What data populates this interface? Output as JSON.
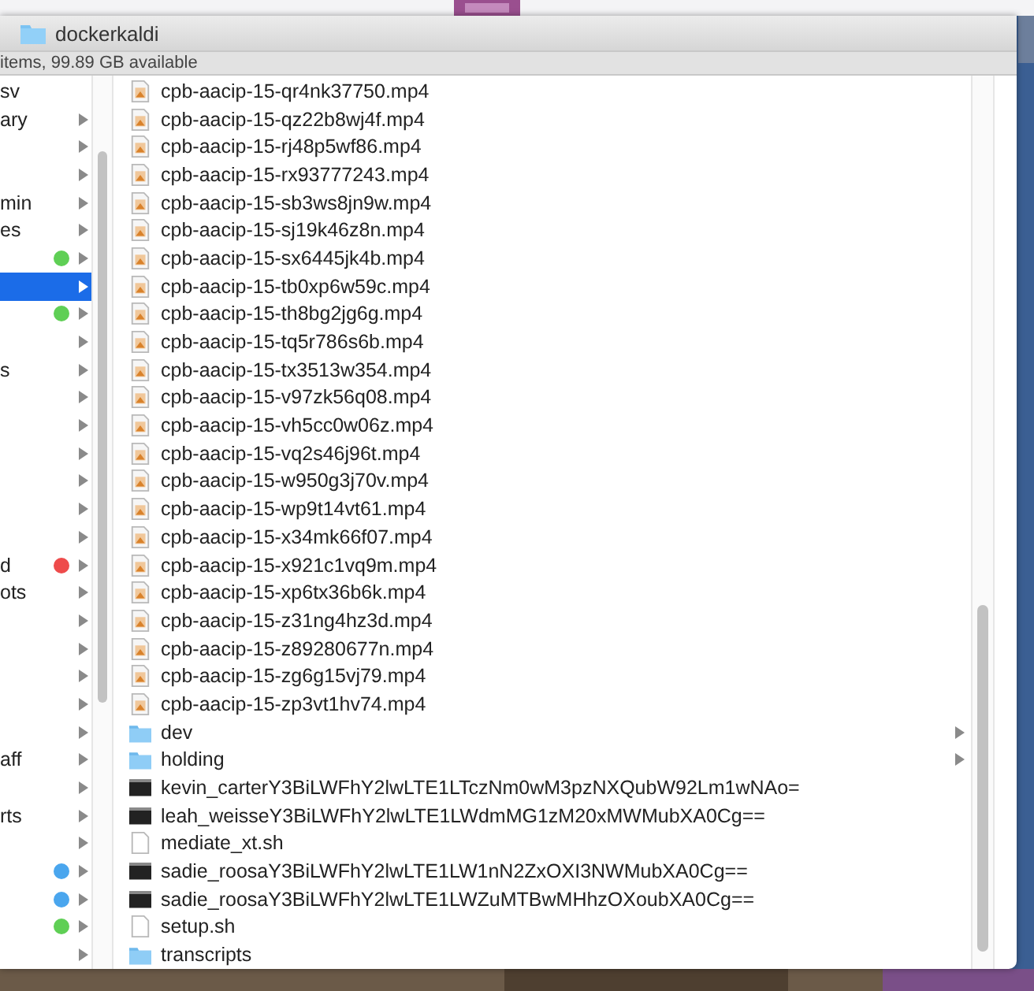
{
  "window": {
    "title": "dockerkaldi"
  },
  "status_bar": "items, 99.89 GB available",
  "left_column": [
    {
      "label": "sv",
      "selected": false,
      "chevron": false
    },
    {
      "label": "ary",
      "selected": false,
      "chevron": true
    },
    {
      "selected": false,
      "chevron": true
    },
    {
      "selected": false,
      "chevron": true
    },
    {
      "label": "min",
      "selected": false,
      "chevron": true
    },
    {
      "label": "es",
      "selected": false,
      "chevron": true
    },
    {
      "selected": false,
      "chevron": true,
      "color": "#5fcf55"
    },
    {
      "selected": true,
      "chevron": true
    },
    {
      "selected": false,
      "chevron": true,
      "color": "#5fcf55"
    },
    {
      "selected": false,
      "chevron": true
    },
    {
      "label": "s",
      "selected": false,
      "chevron": true
    },
    {
      "selected": false,
      "chevron": true
    },
    {
      "selected": false,
      "chevron": true
    },
    {
      "selected": false,
      "chevron": true
    },
    {
      "selected": false,
      "chevron": true
    },
    {
      "selected": false,
      "chevron": true
    },
    {
      "selected": false,
      "chevron": true
    },
    {
      "label": "d",
      "selected": false,
      "chevron": true,
      "color": "#ee4b4b"
    },
    {
      "label": "ots",
      "selected": false,
      "chevron": true
    },
    {
      "selected": false,
      "chevron": true
    },
    {
      "selected": false,
      "chevron": true
    },
    {
      "selected": false,
      "chevron": true
    },
    {
      "selected": false,
      "chevron": true
    },
    {
      "selected": false,
      "chevron": true
    },
    {
      "label": "aff",
      "selected": false,
      "chevron": true
    },
    {
      "selected": false,
      "chevron": true
    },
    {
      "label": "rts",
      "selected": false,
      "chevron": true
    },
    {
      "selected": false,
      "chevron": true
    },
    {
      "selected": false,
      "chevron": true,
      "color": "#4aa6ee"
    },
    {
      "selected": false,
      "chevron": true,
      "color": "#4aa6ee"
    },
    {
      "selected": false,
      "chevron": true,
      "color": "#5fcf55"
    },
    {
      "selected": false,
      "chevron": true
    }
  ],
  "files": [
    {
      "name": "cpb-aacip-15-qr4nk37750.mp4",
      "kind": "video"
    },
    {
      "name": "cpb-aacip-15-qz22b8wj4f.mp4",
      "kind": "video"
    },
    {
      "name": "cpb-aacip-15-rj48p5wf86.mp4",
      "kind": "video"
    },
    {
      "name": "cpb-aacip-15-rx93777243.mp4",
      "kind": "video"
    },
    {
      "name": "cpb-aacip-15-sb3ws8jn9w.mp4",
      "kind": "video"
    },
    {
      "name": "cpb-aacip-15-sj19k46z8n.mp4",
      "kind": "video"
    },
    {
      "name": "cpb-aacip-15-sx6445jk4b.mp4",
      "kind": "video"
    },
    {
      "name": "cpb-aacip-15-tb0xp6w59c.mp4",
      "kind": "video"
    },
    {
      "name": "cpb-aacip-15-th8bg2jg6g.mp4",
      "kind": "video"
    },
    {
      "name": "cpb-aacip-15-tq5r786s6b.mp4",
      "kind": "video"
    },
    {
      "name": "cpb-aacip-15-tx3513w354.mp4",
      "kind": "video"
    },
    {
      "name": "cpb-aacip-15-v97zk56q08.mp4",
      "kind": "video"
    },
    {
      "name": "cpb-aacip-15-vh5cc0w06z.mp4",
      "kind": "video"
    },
    {
      "name": "cpb-aacip-15-vq2s46j96t.mp4",
      "kind": "video"
    },
    {
      "name": "cpb-aacip-15-w950g3j70v.mp4",
      "kind": "video"
    },
    {
      "name": "cpb-aacip-15-wp9t14vt61.mp4",
      "kind": "video"
    },
    {
      "name": "cpb-aacip-15-x34mk66f07.mp4",
      "kind": "video"
    },
    {
      "name": "cpb-aacip-15-x921c1vq9m.mp4",
      "kind": "video"
    },
    {
      "name": "cpb-aacip-15-xp6tx36b6k.mp4",
      "kind": "video"
    },
    {
      "name": "cpb-aacip-15-z31ng4hz3d.mp4",
      "kind": "video"
    },
    {
      "name": "cpb-aacip-15-z89280677n.mp4",
      "kind": "video"
    },
    {
      "name": "cpb-aacip-15-zg6g15vj79.mp4",
      "kind": "video"
    },
    {
      "name": "cpb-aacip-15-zp3vt1hv74.mp4",
      "kind": "video"
    },
    {
      "name": "dev",
      "kind": "folder"
    },
    {
      "name": "holding",
      "kind": "folder"
    },
    {
      "name": "kevin_carterY3BiLWFhY2lwLTE1LTczNm0wM3pzNXQubW92Lm1wNAo=",
      "kind": "executable"
    },
    {
      "name": "leah_weisseY3BiLWFhY2lwLTE1LWdmMG1zM20xMWMubXA0Cg==",
      "kind": "executable"
    },
    {
      "name": "mediate_xt.sh",
      "kind": "document"
    },
    {
      "name": "sadie_roosaY3BiLWFhY2lwLTE1LW1nN2ZxOXI3NWMubXA0Cg==",
      "kind": "executable"
    },
    {
      "name": "sadie_roosaY3BiLWFhY2lwLTE1LWZuMTBwMHhzOXoubXA0Cg==",
      "kind": "executable"
    },
    {
      "name": "setup.sh",
      "kind": "document"
    },
    {
      "name": "transcripts",
      "kind": "folder"
    }
  ]
}
